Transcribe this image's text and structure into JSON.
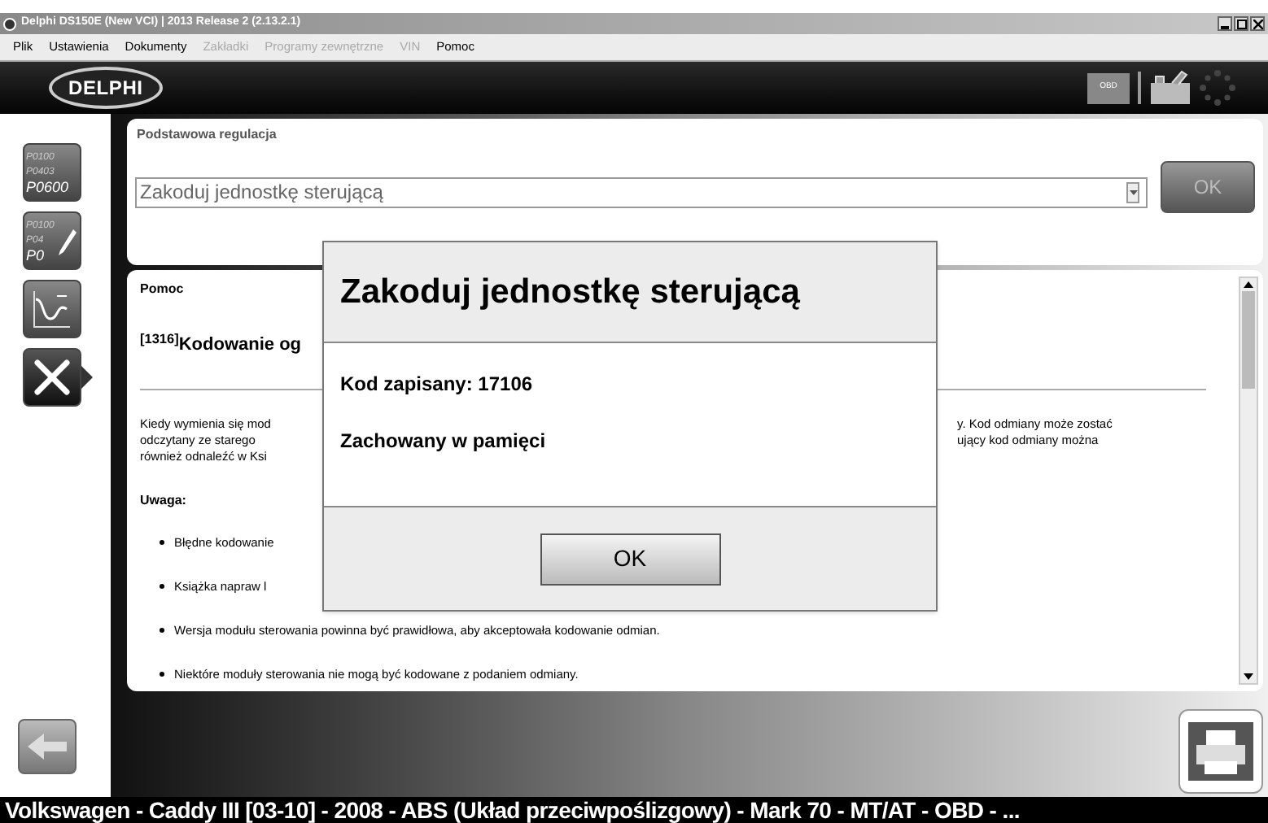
{
  "window": {
    "title": "Delphi DS150E (New VCI) | 2013 Release 2 (2.13.2.1)"
  },
  "menu": [
    {
      "label": "Plik",
      "disabled": false
    },
    {
      "label": "Ustawienia",
      "disabled": false
    },
    {
      "label": "Dokumenty",
      "disabled": false
    },
    {
      "label": "Zakładki",
      "disabled": true
    },
    {
      "label": "Programy zewnętrzne",
      "disabled": true
    },
    {
      "label": "VIN",
      "disabled": true
    },
    {
      "label": "Pomoc",
      "disabled": false
    }
  ],
  "header": {
    "logo": "DELPHI",
    "obd_label": "OBD"
  },
  "sidebar": [
    {
      "kind": "codes",
      "codes": [
        "P0100",
        "P0403",
        "P0600"
      ],
      "selected": false
    },
    {
      "kind": "edit-codes",
      "codes": [
        "P0100",
        "P04",
        "P0"
      ],
      "selected": false
    },
    {
      "kind": "graph",
      "selected": false
    },
    {
      "kind": "tools",
      "selected": true
    }
  ],
  "adjust_panel": {
    "title": "Podstawowa regulacja",
    "combo_value": "Zakoduj jednostkę sterującą",
    "ok_button": {
      "label": "OK",
      "disabled": true
    }
  },
  "help_panel": {
    "title": "Pomoc",
    "heading": "$^{[1316]}$Kodowanie og",
    "paragraph": [
      {
        "left": "Kiedy wymienia się mod",
        "right": "y. Kod odmiany może zostać"
      },
      {
        "left": "odczytany ze starego",
        "right": "ujący kod odmiany można"
      },
      {
        "left": "również odnaleźć w Ksi"
      }
    ],
    "note_title": "Uwaga:",
    "bullets": [
      "Błędne kodowanie",
      "Książka napraw l",
      "Wersja modułu sterowania powinna być prawidłowa, aby akceptowała kodowanie odmian.",
      "Niektóre moduły sterowania nie mogą być kodowane z podaniem odmiany."
    ]
  },
  "dialog": {
    "title": "Zakoduj jednostkę sterującą",
    "lines": [
      "Kod zapisany: 17106",
      "Zachowany w pamięci"
    ],
    "button": "OK"
  },
  "status_bar": "Volkswagen - Caddy III [03-10] - 2008 - ABS (Układ przeciwpoślizgowy) - Mark 70 - MT/AT - OBD - ..."
}
